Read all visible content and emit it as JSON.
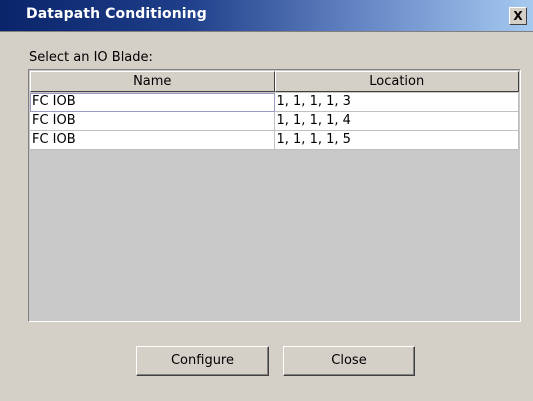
{
  "window": {
    "title": "Datapath Conditioning",
    "close_glyph": "X"
  },
  "prompt": {
    "label": "Select an IO Blade:"
  },
  "table": {
    "columns": [
      "Name",
      "Location"
    ],
    "rows": [
      {
        "name": "FC IOB",
        "location": "1, 1, 1, 1, 3"
      },
      {
        "name": "FC IOB",
        "location": "1, 1, 1, 1, 4"
      },
      {
        "name": "FC IOB",
        "location": "1, 1, 1, 1, 5"
      }
    ]
  },
  "buttons": {
    "configure_label": "Configure",
    "close_label": "Close"
  }
}
